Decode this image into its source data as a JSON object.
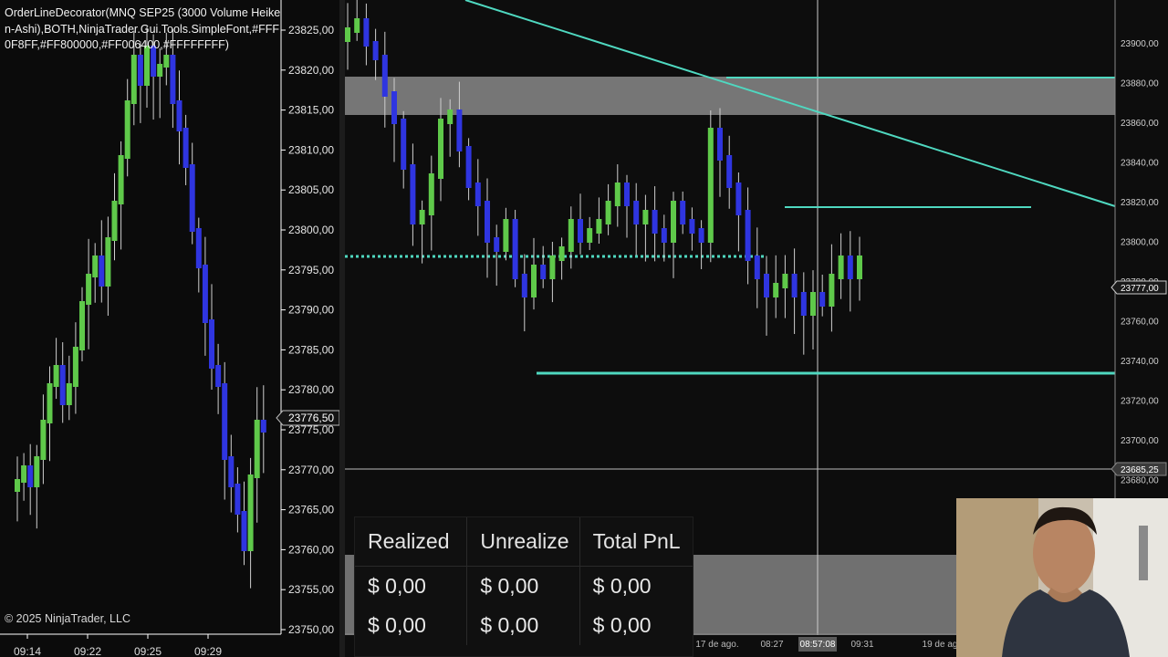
{
  "left_chart": {
    "indicator_label": "OrderLineDecorator(MNQ SEP25 (3000 Volume Heiken-Ashi),BOTH,NinjaTrader.Gui.Tools.SimpleFont,#FFF0F8FF,#FF800000,#FF006400,#FFFFFFFF)",
    "copyright": "© 2025 NinjaTrader, LLC",
    "price_ticks": [
      "23825,00",
      "23820,00",
      "23815,00",
      "23810,00",
      "23805,00",
      "23800,00",
      "23795,00",
      "23790,00",
      "23785,00",
      "23780,00",
      "23775,00",
      "23770,00",
      "23765,00",
      "23760,00",
      "23755,00",
      "23750,00"
    ],
    "current_price": "23776,50",
    "time_ticks": [
      "09:14",
      "09:22",
      "09:25",
      "09:29"
    ]
  },
  "right_chart": {
    "price_ticks": [
      "23900,00",
      "23880,00",
      "23860,00",
      "23840,00",
      "23820,00",
      "23800,00",
      "23780,00",
      "23760,00",
      "23740,00",
      "23720,00",
      "23700,00",
      "23680,00"
    ],
    "current_price": "23777,00",
    "line_price": "23685,25",
    "time_ticks": [
      "17 de ago.",
      "08:27",
      "09:31",
      "19 de ag"
    ],
    "crosshair_time": "08:57:08"
  },
  "pnl": {
    "headers": [
      "Realized",
      "Unrealize",
      "Total PnL"
    ],
    "rows": [
      [
        "$ 0,00",
        "$ 0,00",
        "$ 0,00"
      ],
      [
        "$ 0,00",
        "$ 0,00",
        "$ 0,00"
      ]
    ]
  },
  "colors": {
    "bull": "#5fc94a",
    "bear": "#2f35e0",
    "line": "#4fd8c0",
    "zone": "#8a8a8a"
  }
}
